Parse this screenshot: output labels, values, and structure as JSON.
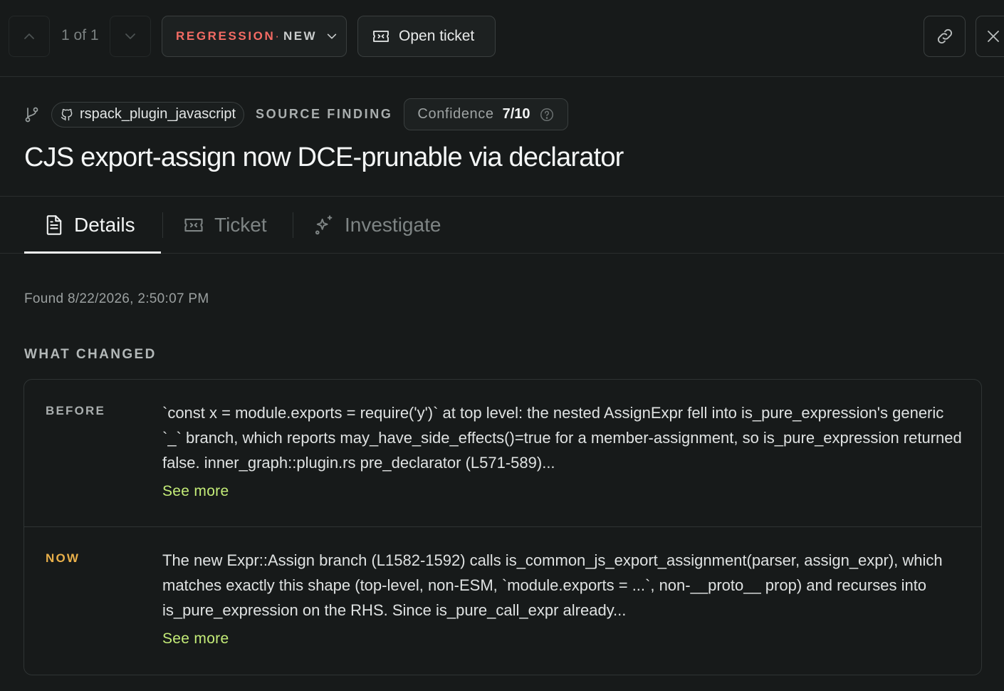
{
  "toolbar": {
    "pager_text": "1 of 1",
    "status_kind": "REGRESSION",
    "status_separator": "·",
    "status_state": "NEW",
    "open_ticket_label": "Open ticket"
  },
  "header": {
    "repo": "rspack_plugin_javascript",
    "source_label": "SOURCE FINDING",
    "confidence_label": "Confidence",
    "confidence_value": "7/10",
    "title": "CJS export-assign now DCE-prunable via declarator"
  },
  "tabs": [
    {
      "label": "Details",
      "icon": "document-icon",
      "active": true
    },
    {
      "label": "Ticket",
      "icon": "ticket-icon",
      "active": false
    },
    {
      "label": "Investigate",
      "icon": "sparkles-icon",
      "active": false
    }
  ],
  "details": {
    "found": "Found 8/22/2026, 2:50:07 PM",
    "section_title": "WHAT CHANGED",
    "before": {
      "label": "BEFORE",
      "text": "`const x = module.exports = require('y')` at top level: the nested AssignExpr fell into is_pure_expression's generic `_` branch, which reports may_have_side_effects()=true for a member-assignment, so is_pure_expression returned false. inner_graph::plugin.rs pre_declarator (L571-589)...",
      "see_more": "See more"
    },
    "now": {
      "label": "NOW",
      "text": "The new Expr::Assign branch (L1582-1592) calls is_common_js_export_assignment(parser, assign_expr), which matches exactly this shape (top-level, non-ESM, `module.exports = ...`, non-__proto__ prop) and recurses into is_pure_expression on the RHS. Since is_pure_call_expr already...",
      "see_more": "See more"
    }
  },
  "colors": {
    "background": "#171a1a",
    "regression": "#f36b64",
    "now_label": "#e9b04a",
    "link": "#c4ec78"
  }
}
